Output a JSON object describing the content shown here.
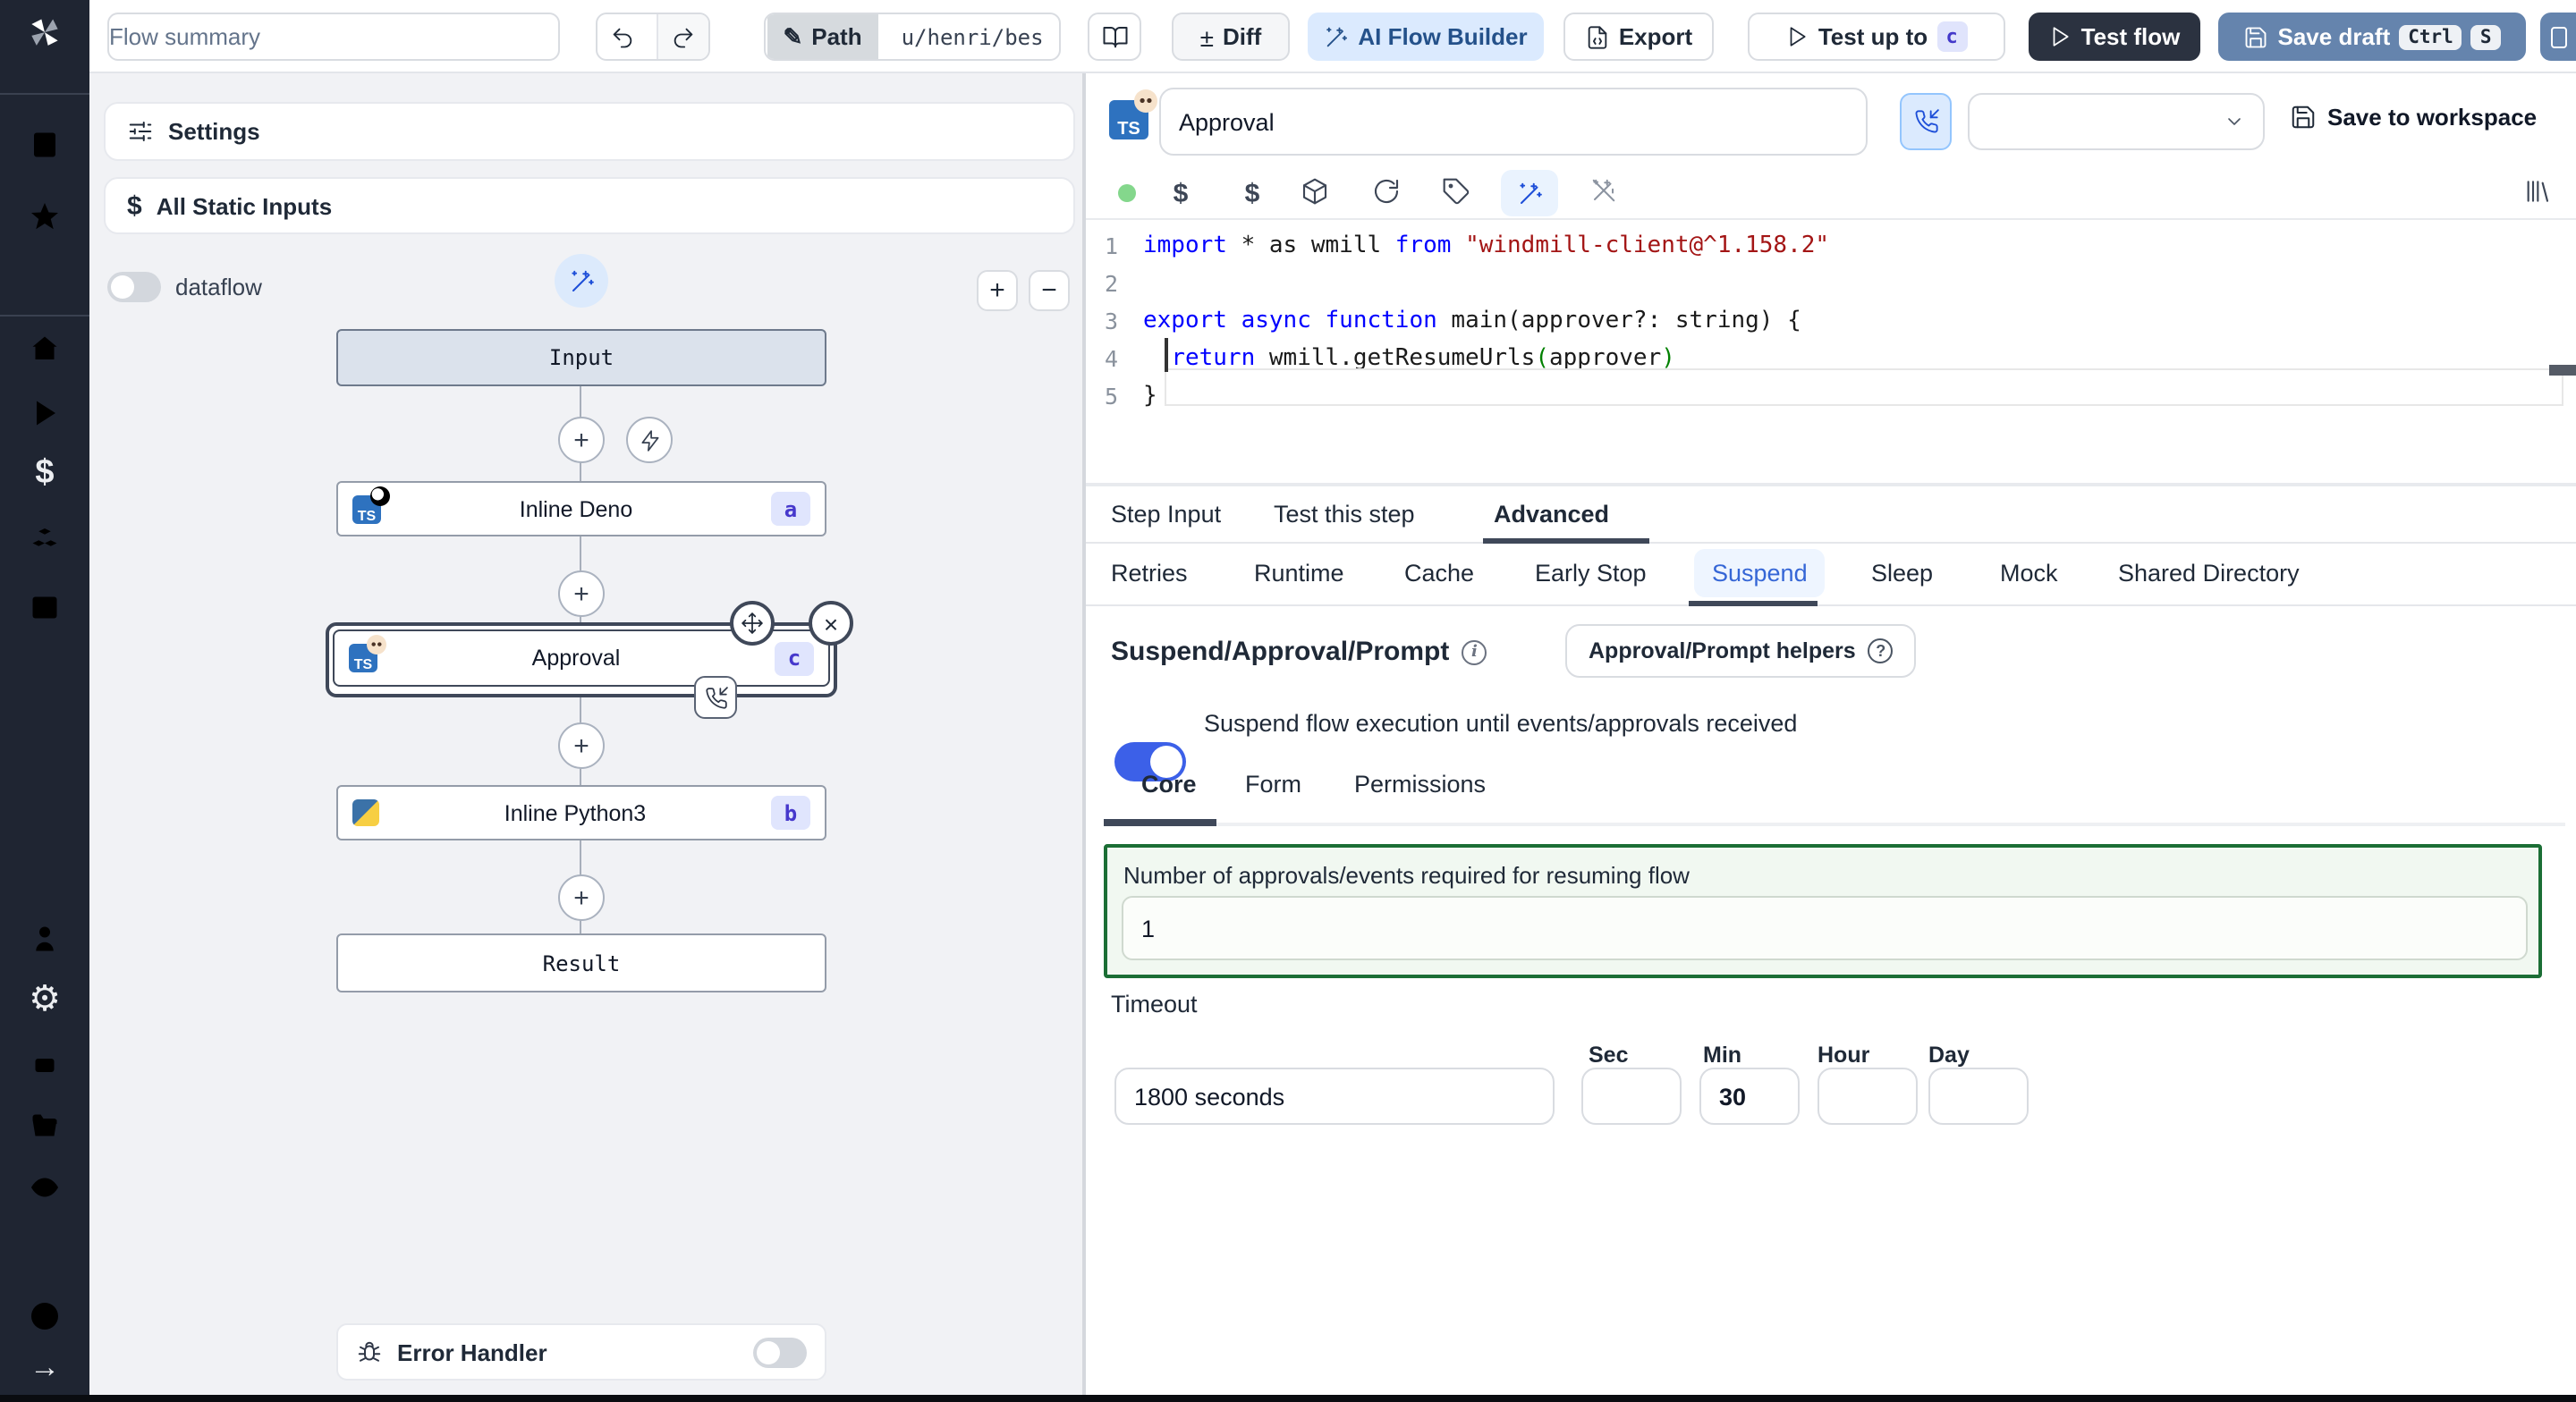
{
  "toolbar": {
    "flow_summary": "Flow summary",
    "path_label": "Path",
    "path_value": "u/henri/bes",
    "diff_label": "Diff",
    "ai_label": "AI Flow Builder",
    "export_label": "Export",
    "test_up_to_label": "Test up to",
    "test_up_to_badge": "c",
    "test_flow_label": "Test flow",
    "save_draft_label": "Save draft",
    "kbd_ctrl": "Ctrl",
    "kbd_s": "S"
  },
  "glyphs": {
    "pencil": "✎",
    "plusminus": "±",
    "dollar": "$",
    "plus": "+",
    "minus": "−",
    "close": "×",
    "gear": "⚙",
    "arrow_right": "→",
    "ts": "TS"
  },
  "sidebar_icon_names": [
    "windmill-logo",
    "building",
    "star",
    "home",
    "play",
    "dollar",
    "cubes",
    "calendar",
    "person",
    "gear",
    "robot",
    "folder",
    "eye",
    "help-circle",
    "arrow-right"
  ],
  "flow_panel": {
    "settings_label": "Settings",
    "static_inputs_label": "All Static Inputs",
    "dataflow_label": "dataflow",
    "graph": {
      "input_label": "Input",
      "deno": {
        "label": "Inline Deno",
        "badge": "a"
      },
      "approval": {
        "label": "Approval",
        "badge": "c"
      },
      "python": {
        "label": "Inline Python3",
        "badge": "b"
      },
      "result_label": "Result",
      "error_handler_label": "Error Handler"
    }
  },
  "right_panel": {
    "header": {
      "title_value": "Approval",
      "save_to_workspace": "Save to workspace"
    },
    "code": {
      "lines": [
        {
          "n": "1",
          "tokens": [
            {
              "t": "import",
              "c": "kw"
            },
            {
              "t": " * as wmill ",
              "c": "pl"
            },
            {
              "t": "from",
              "c": "kw"
            },
            {
              "t": " ",
              "c": "pl"
            },
            {
              "t": "\"windmill-client@^1.158.2\"",
              "c": "str"
            }
          ]
        },
        {
          "n": "2",
          "tokens": []
        },
        {
          "n": "3",
          "tokens": [
            {
              "t": "export",
              "c": "kw"
            },
            {
              "t": " ",
              "c": "pl"
            },
            {
              "t": "async",
              "c": "kw"
            },
            {
              "t": " ",
              "c": "pl"
            },
            {
              "t": "function",
              "c": "kw"
            },
            {
              "t": " main(approver?: string) {",
              "c": "pl"
            }
          ]
        },
        {
          "n": "4",
          "tokens": [
            {
              "t": "  ",
              "c": "pl"
            },
            {
              "t": "return",
              "c": "kw"
            },
            {
              "t": " wmill.getResumeUrls",
              "c": "pl"
            },
            {
              "t": "(",
              "c": "paren"
            },
            {
              "t": "approver",
              "c": "pl"
            },
            {
              "t": ")",
              "c": "paren"
            }
          ]
        },
        {
          "n": "5",
          "tokens": [
            {
              "t": "}",
              "c": "pl"
            }
          ]
        }
      ]
    },
    "tabs": {
      "t0": "Step Input",
      "t1": "Test this step",
      "t2": "Advanced"
    },
    "subtabs": {
      "s0": "Retries",
      "s1": "Runtime",
      "s2": "Cache",
      "s3": "Early Stop",
      "s4": "Suspend",
      "s5": "Sleep",
      "s6": "Mock",
      "s7": "Shared Directory"
    },
    "suspend": {
      "title": "Suspend/Approval/Prompt",
      "helpers_label": "Approval/Prompt helpers",
      "toggle_label": "Suspend flow execution until events/approvals received",
      "core_tabs": {
        "c0": "Core",
        "c1": "Form",
        "c2": "Permissions"
      },
      "approvals_label": "Number of approvals/events required for resuming flow",
      "approvals_value": "1",
      "timeout_label": "Timeout",
      "timeout_value": "1800 seconds",
      "units": {
        "u0": "Sec",
        "u1": "Min",
        "u2": "Hour",
        "u3": "Day"
      },
      "min_value": "30"
    }
  },
  "colors": {
    "sidebar_bg": "#1f2532",
    "accent_blue": "#1d4ed8",
    "ai_button_bg": "#dbeafe",
    "test_flow_bg": "#2b3240",
    "save_draft_bg": "#6584ad",
    "toggle_on": "#3c60e8",
    "badge_bg": "#e0e5fd",
    "badge_text": "#4638cc",
    "green_box_border": "#1b6e35",
    "green_box_bg": "#f1f8f1",
    "status_dot_green": "#84d78c"
  }
}
